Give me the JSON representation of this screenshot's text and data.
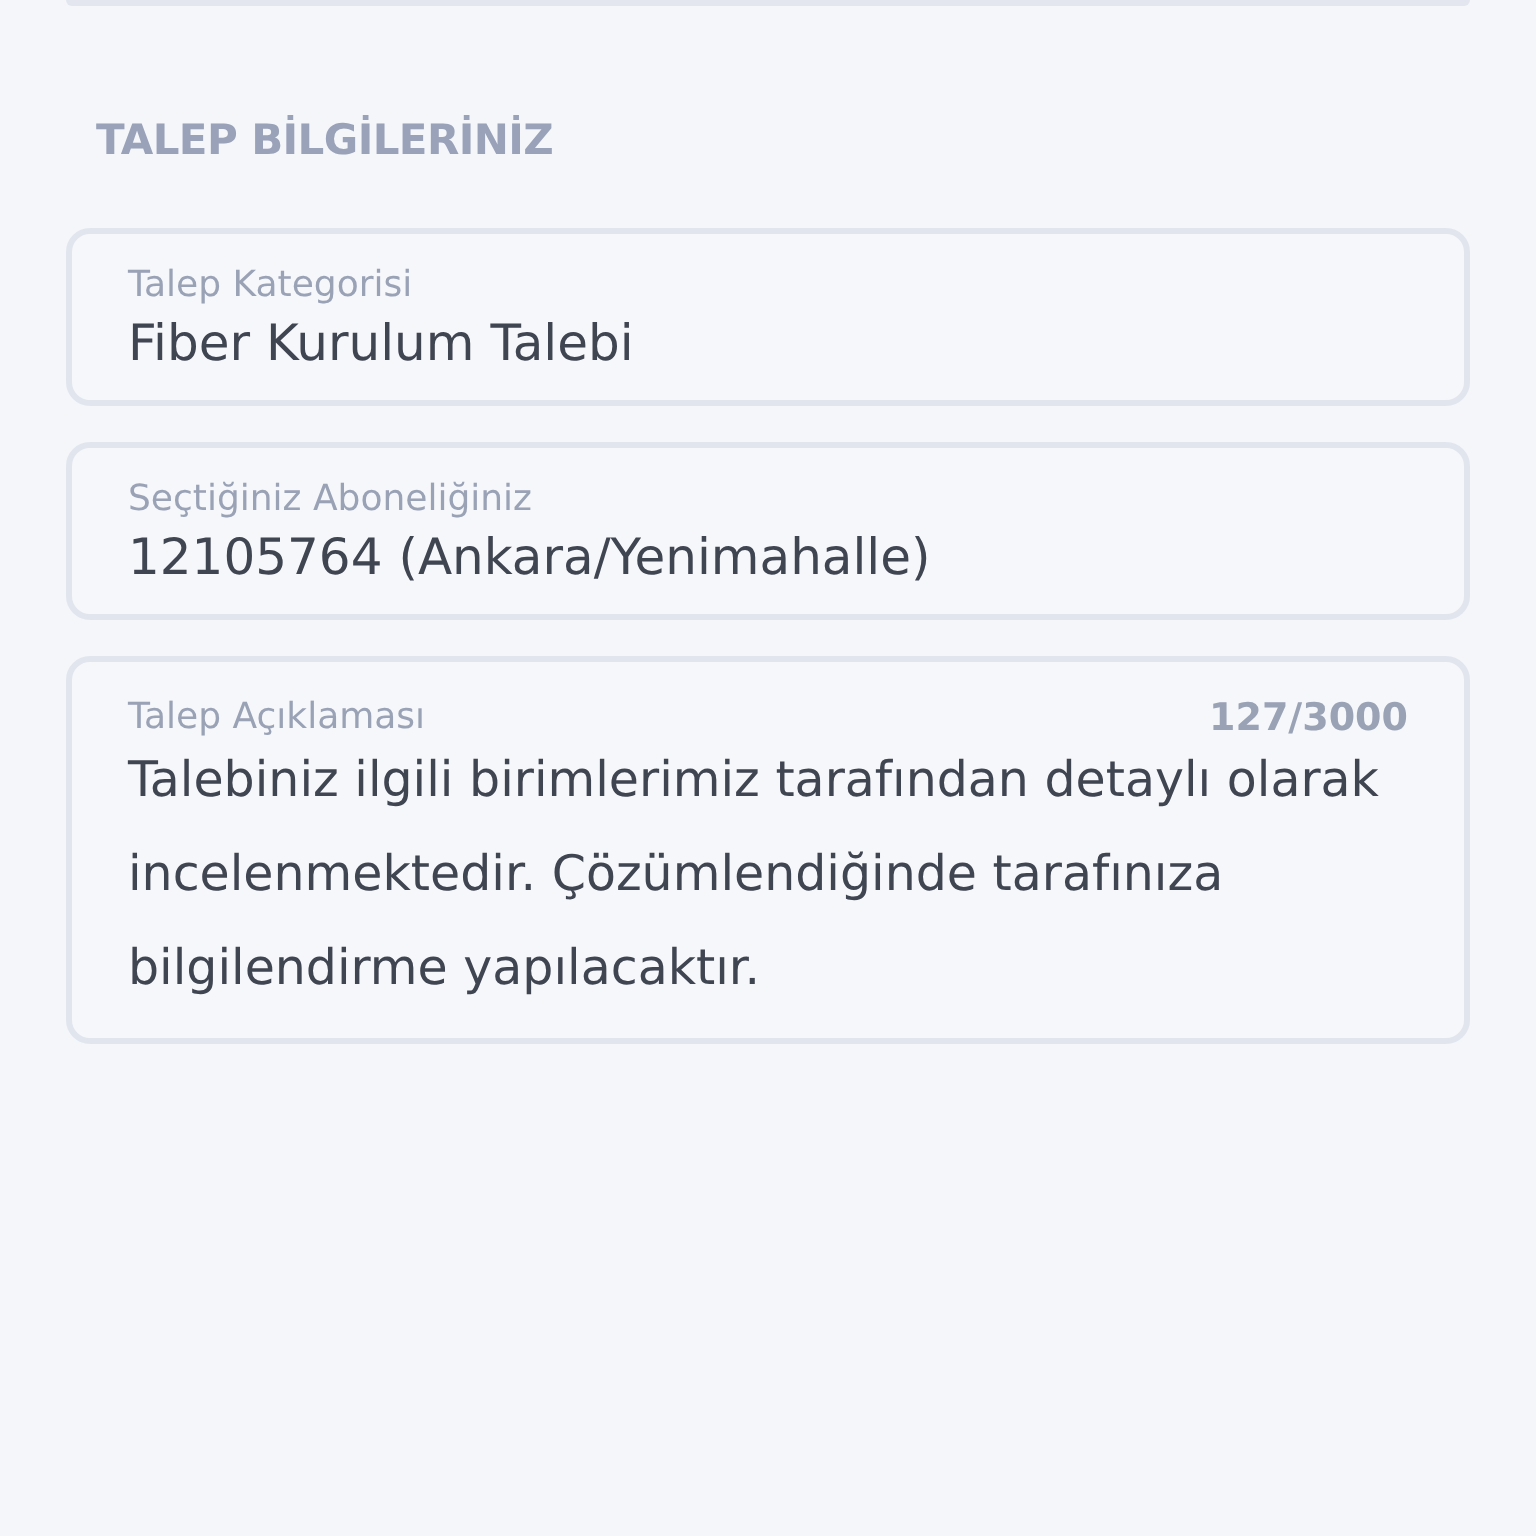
{
  "section_title": "TALEP BİLGİLERİNİZ",
  "fields": [
    {
      "kind": "single",
      "label": "Talep Kategorisi",
      "value": "Fiber Kurulum Talebi"
    },
    {
      "kind": "single",
      "label": "Seçtiğiniz Aboneliğiniz",
      "value": "12105764 (Ankara/Yenimahalle)"
    },
    {
      "kind": "multiline",
      "label": "Talep Açıklaması",
      "counter": "127/3000",
      "value": "Talebiniz ilgili birimlerimiz tarafından detaylı olarak incelenmektedir. Çözümlendiğinde tarafınıza bilgilendirme yapılacaktır."
    }
  ]
}
